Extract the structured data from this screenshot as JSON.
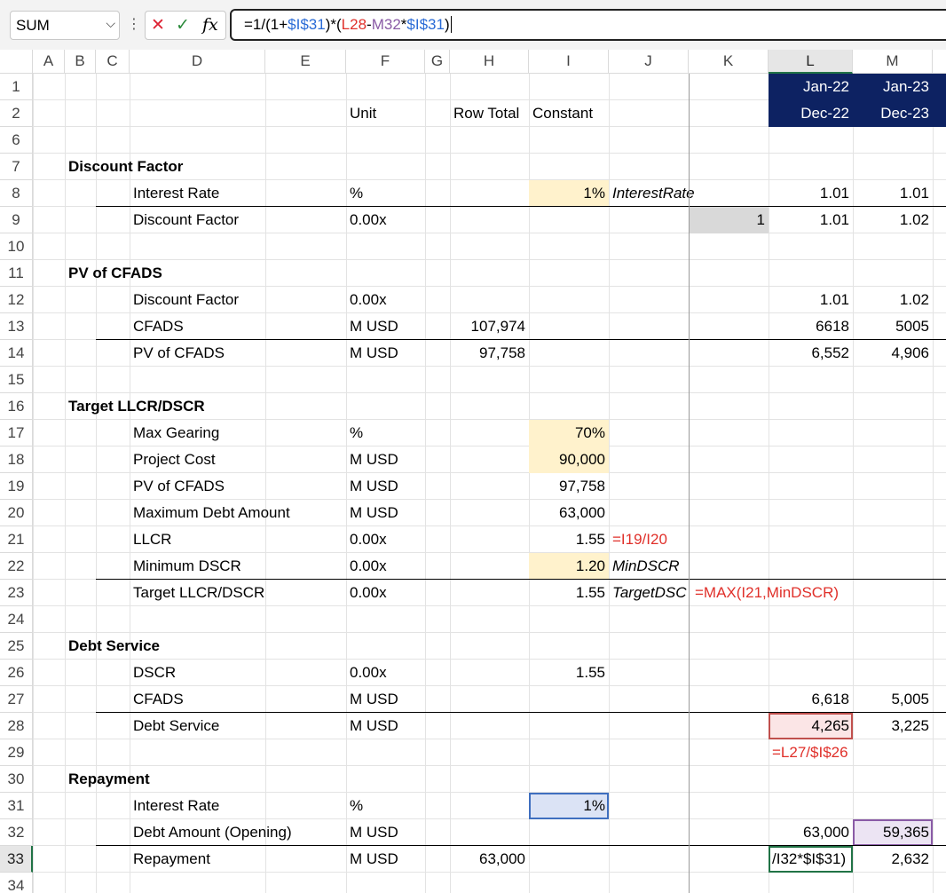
{
  "formula_bar": {
    "name_box": "SUM",
    "menu_dots": "⋮",
    "cancel_glyph": "✕",
    "confirm_glyph": "✓",
    "fx_glyph": "fx",
    "formula_parts": [
      "=1/(1+",
      "$I$31",
      ")*(",
      "L28",
      "-",
      "M32",
      "*",
      "$I$31",
      ")"
    ]
  },
  "colors": {
    "navy": "#0d2262",
    "input_yellow": "#fff2cc",
    "red_formula": "#e0302a",
    "selection_green": "#217346"
  },
  "columns": [
    "A",
    "B",
    "C",
    "D",
    "E",
    "F",
    "G",
    "H",
    "I",
    "J",
    "K",
    "L",
    "M"
  ],
  "rows": [
    "1",
    "2",
    "6",
    "7",
    "8",
    "9",
    "10",
    "11",
    "12",
    "13",
    "14",
    "15",
    "16",
    "17",
    "18",
    "19",
    "20",
    "21",
    "22",
    "23",
    "24",
    "25",
    "26",
    "27",
    "28",
    "29",
    "30",
    "31",
    "32",
    "33",
    "34"
  ],
  "header_cells": {
    "unit": "Unit",
    "row_total": "Row Total",
    "constant": "Constant",
    "L1": "Jan-22",
    "M1": "Jan-23",
    "L2": "Dec-22",
    "M2": "Dec-23"
  },
  "cells": {
    "D7": "Discount Factor",
    "D8": "Interest Rate",
    "F8": "%",
    "I8": "1%",
    "J8": "InterestRate",
    "L8": "1.01",
    "M8": "1.01",
    "D9": "Discount Factor",
    "F9": "0.00x",
    "K9": "1",
    "L9": "1.01",
    "M9": "1.02",
    "D11": "PV of CFADS",
    "D12": "Discount Factor",
    "F12": "0.00x",
    "L12": "1.01",
    "M12": "1.02",
    "D13": "CFADS",
    "F13": "M USD",
    "H13": "107,974",
    "L13": "6618",
    "M13": "5005",
    "D14": "PV of CFADS",
    "F14": "M USD",
    "H14": "97,758",
    "L14": "6,552",
    "M14": "4,906",
    "D16": "Target LLCR/DSCR",
    "D17": "Max Gearing",
    "F17": "%",
    "I17": "70%",
    "D18": "Project Cost",
    "F18": "M USD",
    "I18": "90,000",
    "D19": "PV of CFADS",
    "F19": "M USD",
    "I19": "97,758",
    "D20": "Maximum Debt Amount",
    "F20": "M USD",
    "I20": "63,000",
    "D21": "LLCR",
    "F21": "0.00x",
    "I21": "1.55",
    "J21": "=I19/I20",
    "D22": "Minimum DSCR",
    "F22": "0.00x",
    "I22": "1.20",
    "J22": "MinDSCR",
    "D23": "Target LLCR/DSCR",
    "F23": "0.00x",
    "I23": "1.55",
    "J23": "TargetDSC",
    "K23": "=MAX(I21,MinDSCR)",
    "D25": "Debt Service",
    "D26": "DSCR",
    "F26": "0.00x",
    "I26": "1.55",
    "D27": "CFADS",
    "F27": "M USD",
    "L27": "6,618",
    "M27": "5,005",
    "D28": "Debt Service",
    "F28": "M USD",
    "L28": "4,265",
    "M28": "3,225",
    "L29": "=L27/$I$26",
    "D30": "Repayment",
    "D31": "Interest Rate",
    "F31": "%",
    "I31": "1%",
    "D32": "Debt Amount (Opening)",
    "F32": "M USD",
    "L32": "63,000",
    "M32": "59,365",
    "D33": "Repayment",
    "F33": "M USD",
    "H33": "63,000",
    "L33": "/I32*$I$31)",
    "M33": "2,632"
  }
}
